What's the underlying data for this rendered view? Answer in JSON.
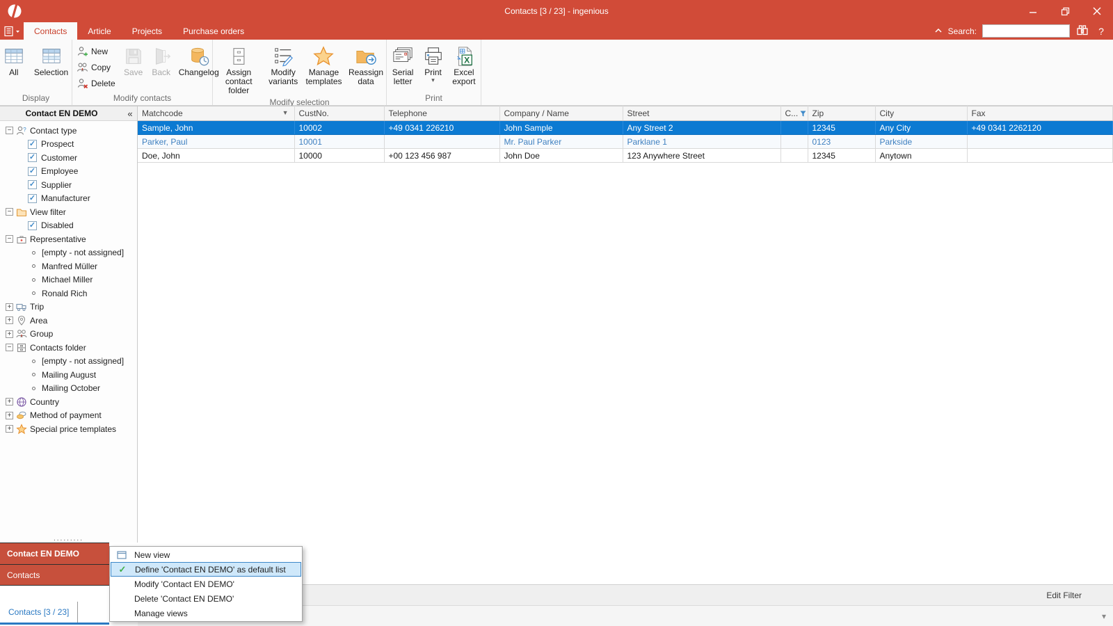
{
  "window": {
    "title": "Contacts [3 / 23] - ingenious"
  },
  "nav": {
    "tabs": [
      {
        "label": "Contacts",
        "active": true
      },
      {
        "label": "Article",
        "active": false
      },
      {
        "label": "Projects",
        "active": false
      },
      {
        "label": "Purchase orders",
        "active": false
      }
    ]
  },
  "search": {
    "label": "Search:",
    "value": "",
    "help_label": "?"
  },
  "ribbon": {
    "groups": [
      {
        "label": "Display"
      },
      {
        "label": "Modify contacts"
      },
      {
        "label": "Modify selection"
      },
      {
        "label": "Print"
      }
    ],
    "buttons": {
      "all": "All",
      "selection": "Selection",
      "new": "New",
      "copy": "Copy",
      "delete": "Delete",
      "save": "Save",
      "back": "Back",
      "changelog": "Changelog",
      "assign_contact_folder": "Assign contact folder",
      "modify_variants": "Modify variants",
      "manage_templates": "Manage templates",
      "reassign_data": "Reassign data",
      "serial_letter": "Serial letter",
      "print": "Print",
      "excel_export": "Excel export"
    }
  },
  "sidebar": {
    "title": "Contact EN DEMO",
    "groups": [
      {
        "label": "Contact type",
        "expanded": true,
        "children": [
          "Prospect",
          "Customer",
          "Employee",
          "Supplier",
          "Manufacturer"
        ]
      },
      {
        "label": "View filter",
        "expanded": true,
        "children": [
          "Disabled"
        ]
      },
      {
        "label": "Representative",
        "expanded": true,
        "children": [
          "[empty - not assigned]",
          "Manfred Müller",
          "Michael Miller",
          "Ronald Rich"
        ]
      },
      {
        "label": "Trip",
        "expanded": false,
        "children": []
      },
      {
        "label": "Area",
        "expanded": false,
        "children": []
      },
      {
        "label": "Group",
        "expanded": false,
        "children": []
      },
      {
        "label": "Contacts folder",
        "expanded": true,
        "children": [
          "[empty - not assigned]",
          "Mailing August",
          "Mailing October"
        ]
      },
      {
        "label": "Country",
        "expanded": false,
        "children": []
      },
      {
        "label": "Method of payment",
        "expanded": false,
        "children": []
      },
      {
        "label": "Special price templates",
        "expanded": false,
        "children": []
      }
    ]
  },
  "grid": {
    "columns": [
      "Matchcode",
      "CustNo.",
      "Telephone",
      "Company / Name",
      "Street",
      "C...",
      "Zip",
      "City",
      "Fax"
    ],
    "sorted_column": "Matchcode",
    "filtered_column": "C...",
    "rows": [
      {
        "state": "selected",
        "cells": [
          "Sample, John",
          "10002",
          "+49 0341 226210",
          "John Sample",
          "Any Street 2",
          "",
          "12345",
          "Any City",
          "+49 0341 2262120"
        ]
      },
      {
        "state": "dimmed",
        "cells": [
          "Parker, Paul",
          "10001",
          "",
          "Mr. Paul Parker",
          "Parklane 1",
          "",
          "0123",
          "Parkside",
          ""
        ]
      },
      {
        "state": "normal",
        "cells": [
          "Doe, John",
          "10000",
          "+00 123 456 987",
          "John Doe",
          "123 Anywhere Street",
          "",
          "12345",
          "Anytown",
          ""
        ]
      }
    ]
  },
  "views_panel": {
    "item1": "Contact EN DEMO",
    "item2": "Contacts",
    "tab": "Contacts [3 / 23]"
  },
  "context_menu": {
    "items": [
      {
        "label": "New view"
      },
      {
        "label": "Define 'Contact EN DEMO' as default list",
        "highlighted": true
      },
      {
        "label": "Modify 'Contact EN DEMO'"
      },
      {
        "label": "Delete 'Contact EN DEMO'"
      },
      {
        "label": "Manage views"
      }
    ]
  },
  "status": {
    "edit_filter": "Edit Filter"
  },
  "colors": {
    "accent_red": "#d14b38",
    "panel_red": "#c7503c",
    "selection_blue": "#0c7ad2",
    "link_blue": "#2b79c2",
    "check_green": "#3fae49"
  }
}
